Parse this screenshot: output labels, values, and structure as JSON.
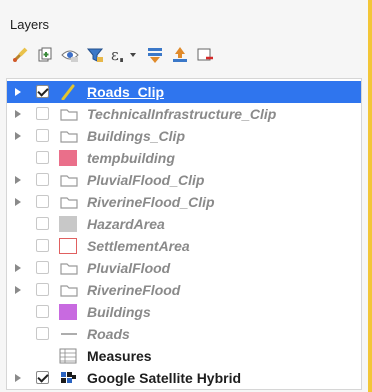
{
  "panel": {
    "title": "Layers"
  },
  "toolbar": [
    {
      "name": "style-brush-icon"
    },
    {
      "name": "add-group-icon"
    },
    {
      "name": "visibility-eye-icon"
    },
    {
      "name": "filter-icon"
    },
    {
      "name": "expression-filter-icon"
    },
    {
      "name": "expand-all-icon"
    },
    {
      "name": "collapse-all-icon"
    },
    {
      "name": "remove-layer-icon"
    }
  ],
  "layers": [
    {
      "label": "Roads_Clip",
      "checked": true,
      "expandable": true,
      "selected": true,
      "symbol": "line-yellow",
      "style": "sel"
    },
    {
      "label": "TechnicalInfrastructure_Clip",
      "checked": false,
      "expandable": true,
      "symbol": "group",
      "style": "hidden"
    },
    {
      "label": "Buildings_Clip",
      "checked": false,
      "expandable": true,
      "symbol": "group",
      "style": "hidden"
    },
    {
      "label": "tempbuilding",
      "checked": false,
      "expandable": false,
      "symbol": "fill",
      "color": "#ea6f8a",
      "style": "hidden"
    },
    {
      "label": "PluvialFlood_Clip",
      "checked": false,
      "expandable": true,
      "symbol": "group",
      "style": "hidden"
    },
    {
      "label": "RiverineFlood_Clip",
      "checked": false,
      "expandable": true,
      "symbol": "group",
      "style": "hidden"
    },
    {
      "label": "HazardArea",
      "checked": false,
      "expandable": false,
      "symbol": "fill",
      "color": "#c8c8c8",
      "style": "hidden"
    },
    {
      "label": "SettlementArea",
      "checked": false,
      "expandable": false,
      "symbol": "outline",
      "color": "#e06060",
      "style": "hidden"
    },
    {
      "label": "PluvialFlood",
      "checked": false,
      "expandable": true,
      "symbol": "group",
      "style": "hidden"
    },
    {
      "label": "RiverineFlood",
      "checked": false,
      "expandable": true,
      "symbol": "group",
      "style": "hidden"
    },
    {
      "label": "Buildings",
      "checked": false,
      "expandable": false,
      "symbol": "fill",
      "color": "#c86ae0",
      "style": "hidden"
    },
    {
      "label": "Roads",
      "checked": false,
      "expandable": false,
      "symbol": "line-gray",
      "style": "hidden"
    },
    {
      "label": "Measures",
      "checked": null,
      "expandable": false,
      "symbol": "table",
      "style": "visible"
    },
    {
      "label": "Google Satellite Hybrid",
      "checked": true,
      "expandable": true,
      "symbol": "raster",
      "style": "visible"
    }
  ]
}
